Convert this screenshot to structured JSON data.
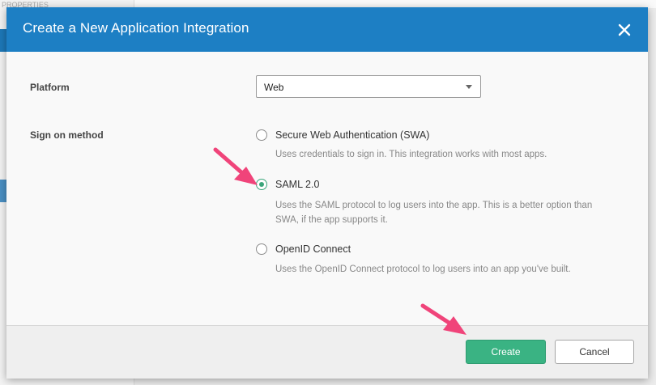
{
  "background": {
    "label_top": "PROPERTIES"
  },
  "modal": {
    "title": "Create a New Application Integration",
    "close_icon": "close-icon"
  },
  "form": {
    "platform_label": "Platform",
    "platform_value": "Web",
    "sign_on_label": "Sign on method",
    "options": [
      {
        "label": "Secure Web Authentication (SWA)",
        "description": "Uses credentials to sign in. This integration works with most apps.",
        "checked": false
      },
      {
        "label": "SAML 2.0",
        "description": "Uses the SAML protocol to log users into the app. This is a better option than SWA, if the app supports it.",
        "checked": true
      },
      {
        "label": "OpenID Connect",
        "description": "Uses the OpenID Connect protocol to log users into an app you've built.",
        "checked": false
      }
    ]
  },
  "footer": {
    "create_label": "Create",
    "cancel_label": "Cancel"
  },
  "colors": {
    "header": "#1d7fc4",
    "accent_green": "#3ab383",
    "annotation_arrow": "#f0447a"
  }
}
